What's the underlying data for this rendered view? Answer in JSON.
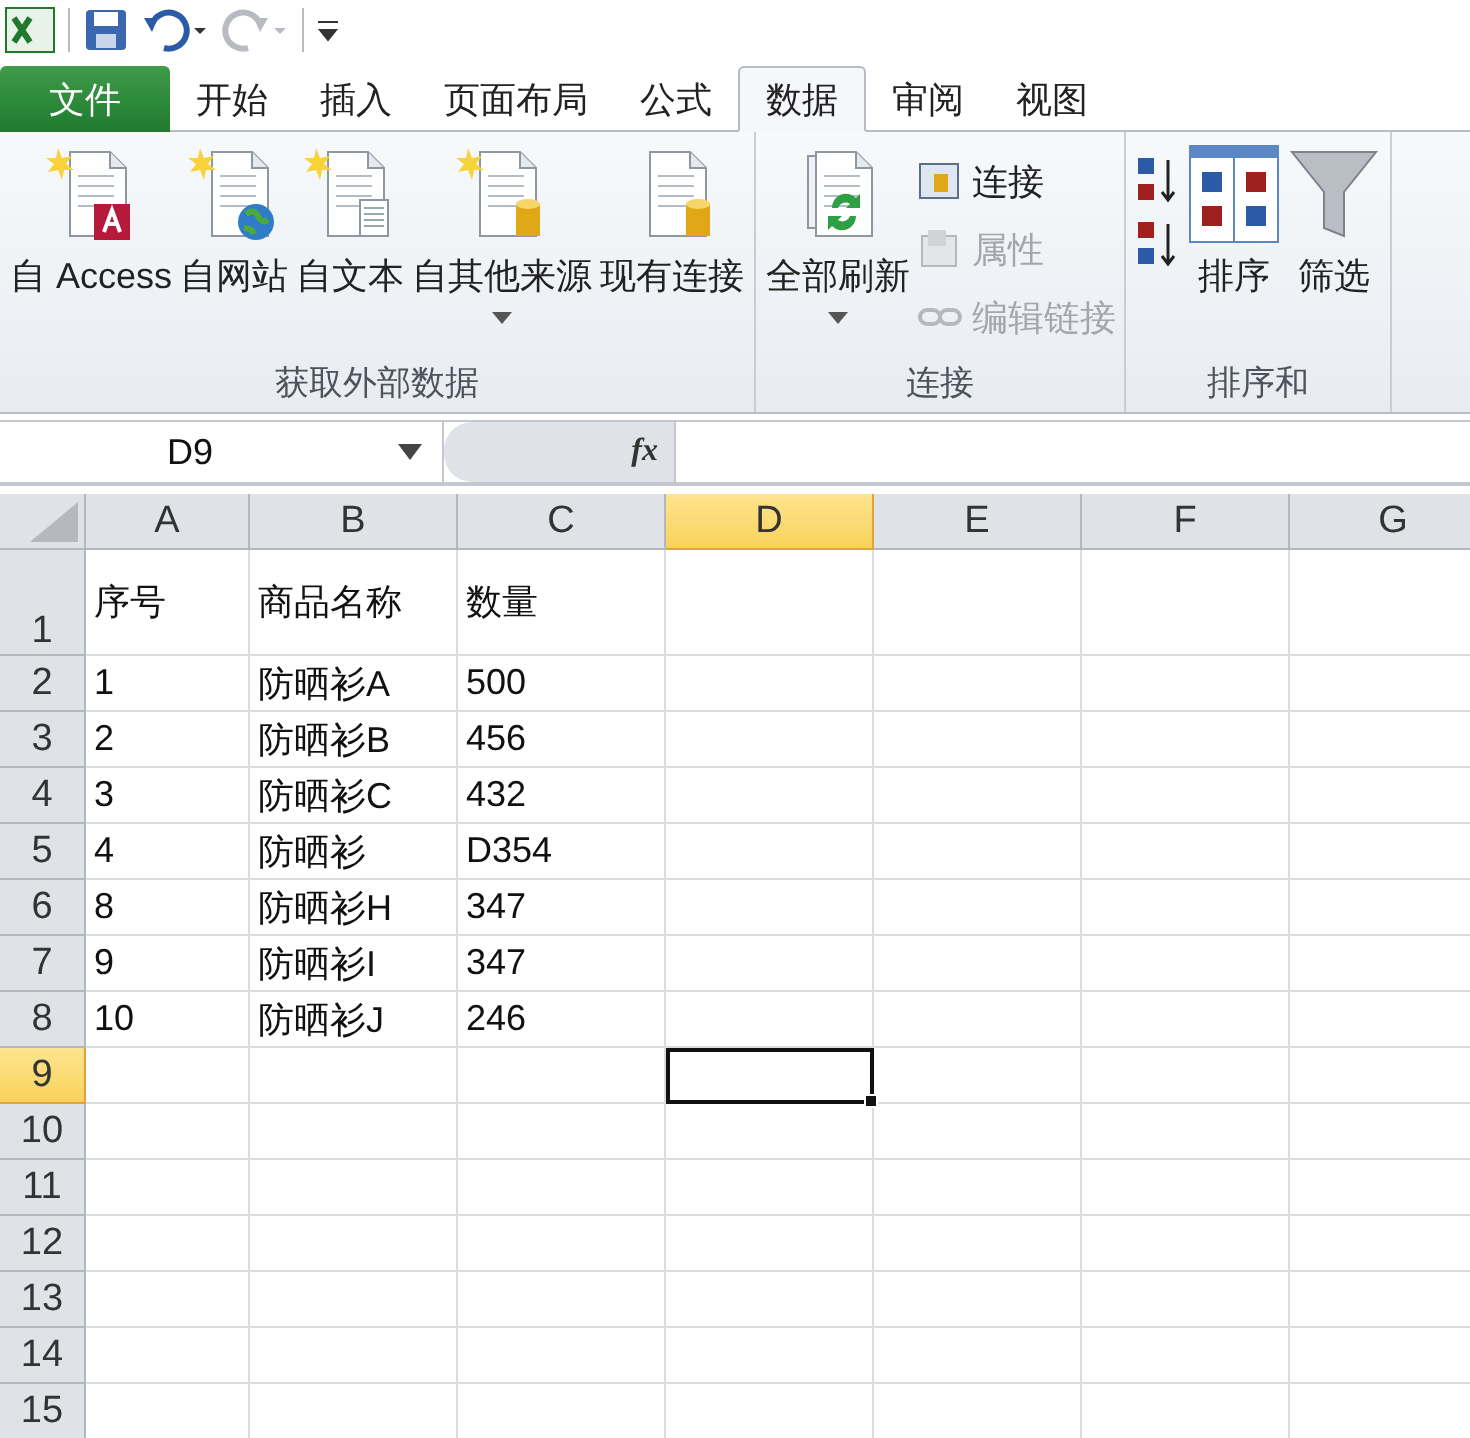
{
  "tabs": [
    {
      "label": "文件",
      "kind": "file",
      "selected": false
    },
    {
      "label": "开始",
      "kind": "tab",
      "selected": false
    },
    {
      "label": "插入",
      "kind": "tab",
      "selected": false
    },
    {
      "label": "页面布局",
      "kind": "tab",
      "selected": false
    },
    {
      "label": "公式",
      "kind": "tab",
      "selected": false
    },
    {
      "label": "数据",
      "kind": "tab",
      "selected": true
    },
    {
      "label": "审阅",
      "kind": "tab",
      "selected": false
    },
    {
      "label": "视图",
      "kind": "tab",
      "selected": false
    }
  ],
  "ribbon": {
    "groups": [
      {
        "label": "获取外部数据",
        "buttons": [
          {
            "kind": "large",
            "label": "自 Access",
            "dropdown": false
          },
          {
            "kind": "large",
            "label": "自网站",
            "dropdown": false
          },
          {
            "kind": "large",
            "label": "自文本",
            "dropdown": false
          },
          {
            "kind": "large",
            "label": "自其他来源",
            "dropdown": true
          },
          {
            "kind": "large",
            "label": "现有连接",
            "dropdown": false
          }
        ]
      },
      {
        "label": "连接",
        "buttons": [
          {
            "kind": "large",
            "label": "全部刷新",
            "dropdown": true
          },
          {
            "kind": "small",
            "label": "连接",
            "disabled": false
          },
          {
            "kind": "small",
            "label": "属性",
            "disabled": true
          },
          {
            "kind": "small",
            "label": "编辑链接",
            "disabled": true
          }
        ]
      },
      {
        "label": "排序和",
        "buttons": [
          {
            "kind": "icon"
          },
          {
            "kind": "icon"
          },
          {
            "kind": "large",
            "label": "排序",
            "dropdown": false
          },
          {
            "kind": "large",
            "label": "筛选",
            "dropdown": false
          }
        ]
      }
    ]
  },
  "formula_bar": {
    "name_box": "D9",
    "function_button": "fx"
  },
  "sheet": {
    "columns": [
      {
        "label": "A",
        "selected": false
      },
      {
        "label": "B",
        "selected": false
      },
      {
        "label": "C",
        "selected": false
      },
      {
        "label": "D",
        "selected": true
      },
      {
        "label": "E",
        "selected": false
      },
      {
        "label": "F",
        "selected": false
      },
      {
        "label": "G",
        "selected": false
      }
    ],
    "rows": [
      {
        "header": "1",
        "selected": false,
        "cells": [
          "序号",
          "商品名称",
          "数量"
        ]
      },
      {
        "header": "2",
        "selected": false,
        "cells": [
          "1",
          "防晒衫A",
          "500"
        ]
      },
      {
        "header": "3",
        "selected": false,
        "cells": [
          "2",
          "防晒衫B",
          "456"
        ]
      },
      {
        "header": "4",
        "selected": false,
        "cells": [
          "3",
          "防晒衫C",
          "432"
        ]
      },
      {
        "header": "5",
        "selected": false,
        "cells": [
          "4",
          "防晒衫",
          "D354"
        ]
      },
      {
        "header": "6",
        "selected": false,
        "cells": [
          "8",
          "防晒衫H",
          "347"
        ]
      },
      {
        "header": "7",
        "selected": false,
        "cells": [
          "9",
          "防晒衫I",
          "347"
        ]
      },
      {
        "header": "8",
        "selected": false,
        "cells": [
          "10",
          "防晒衫J",
          "246"
        ]
      },
      {
        "header": "9",
        "selected": true
      },
      {
        "header": "10",
        "selected": false
      },
      {
        "header": "11",
        "selected": false
      },
      {
        "header": "12",
        "selected": false
      },
      {
        "header": "13",
        "selected": false
      },
      {
        "header": "14",
        "selected": false
      },
      {
        "header": "15",
        "selected": false
      }
    ]
  }
}
